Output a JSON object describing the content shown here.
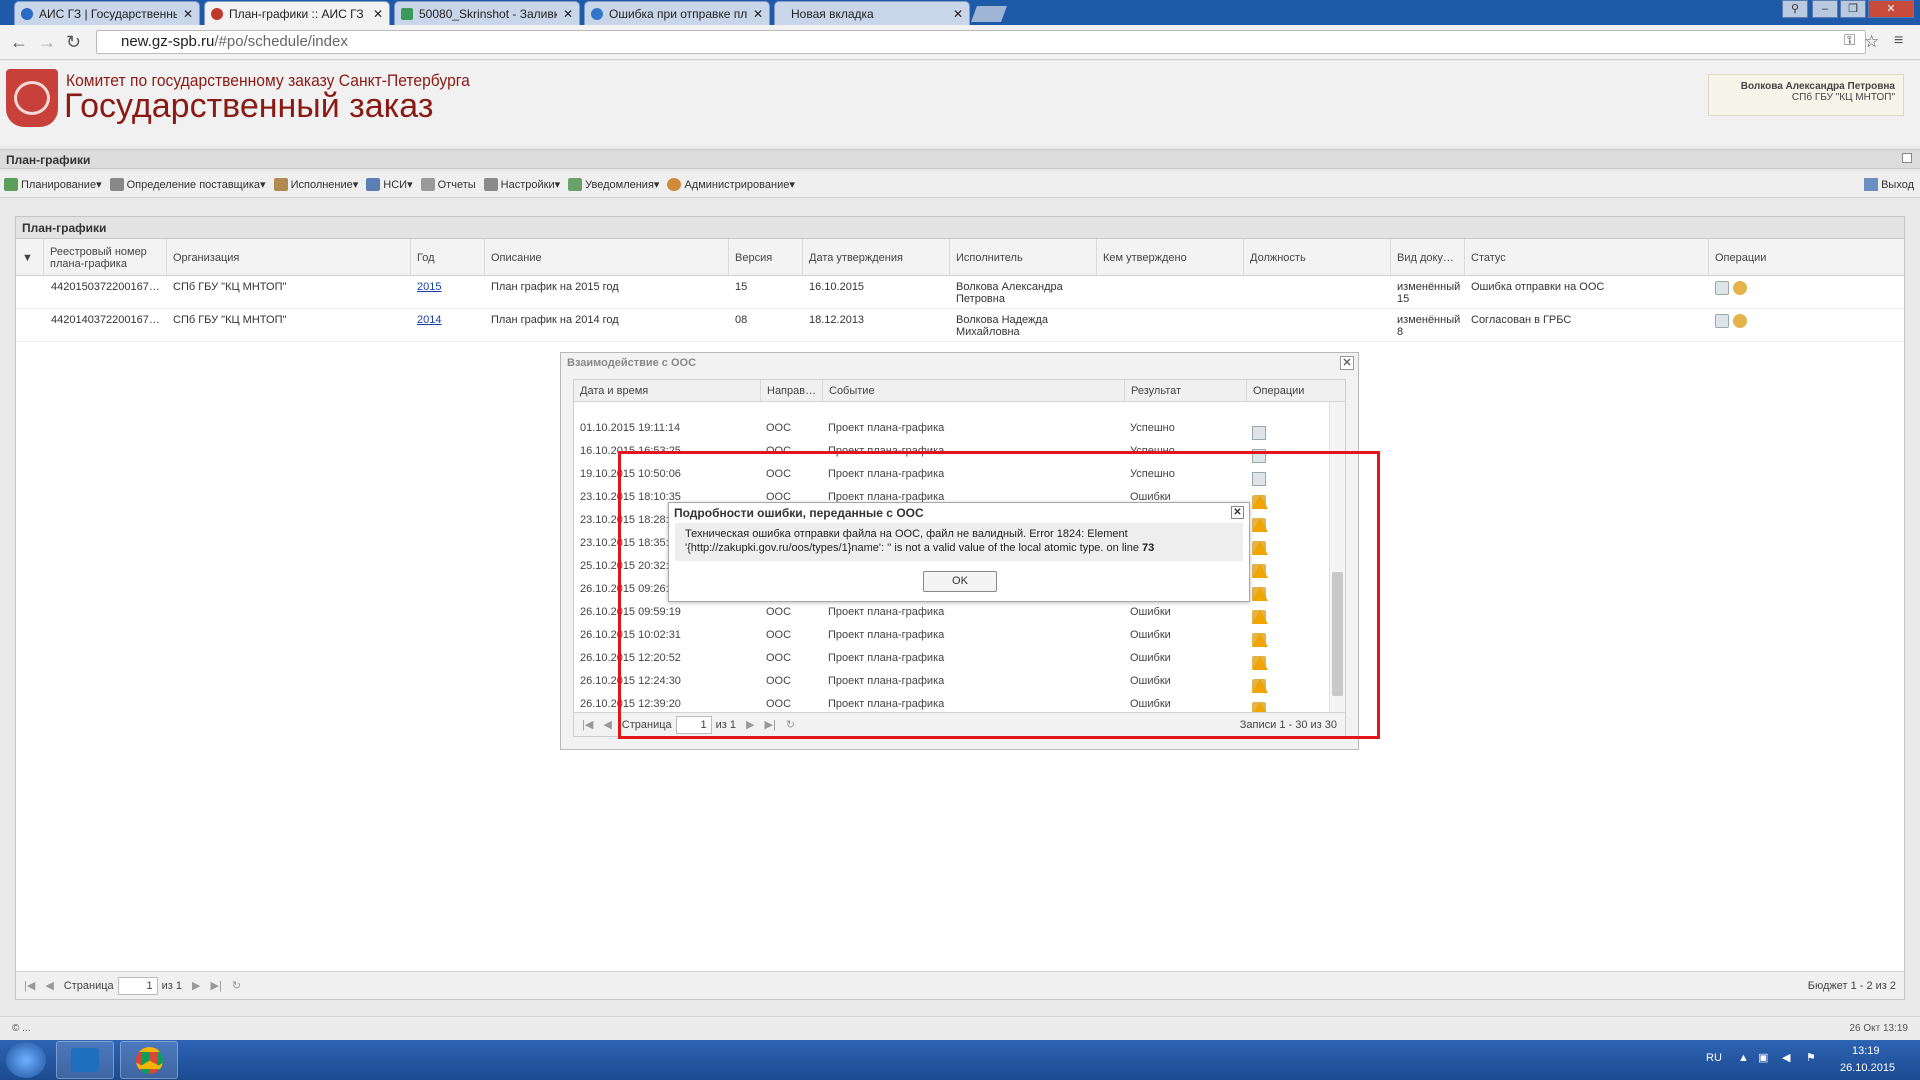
{
  "browser": {
    "tabs": [
      {
        "label": "АИС ГЗ | Государственный"
      },
      {
        "label": "План-графики :: АИС ГЗ"
      },
      {
        "label": "50080_Skrinshot - Заливка"
      },
      {
        "label": "Ошибка при отправке пл"
      },
      {
        "label": "Новая вкладка"
      }
    ],
    "url_host": "new.gz-spb.ru",
    "url_path": "/#po/schedule/index"
  },
  "header": {
    "org": "Комитет по государственному заказу Санкт-Петербурга",
    "site": "Государственный заказ",
    "user_name": "Волкова Александра Петровна",
    "user_org": "СПб ГБУ \"КЦ МНТОП\""
  },
  "module_title": "План-графики",
  "menu": [
    {
      "label": "Планирование",
      "icon": "planning-icon",
      "color": "#5aa05a"
    },
    {
      "label": "Определение поставщика",
      "icon": "gear-icon",
      "color": "#888888"
    },
    {
      "label": "Исполнение",
      "icon": "execution-icon",
      "color": "#b08a50"
    },
    {
      "label": "НСИ",
      "icon": "table-icon",
      "color": "#5a7fb5"
    },
    {
      "label": "Отчеты",
      "icon": "report-icon",
      "color": "#9a9a9a"
    },
    {
      "label": "Настройки",
      "icon": "wrench-icon",
      "color": "#8a8a8a"
    },
    {
      "label": "Уведомления",
      "icon": "notify-icon",
      "color": "#6aa06a"
    },
    {
      "label": "Администрирование",
      "icon": "user-icon",
      "color": "#d08a3a"
    }
  ],
  "exit_label": "Выход",
  "panel": {
    "title": "План-графики",
    "columns": [
      "Реестровый номер плана-графика",
      "Организация",
      "Год",
      "Описание",
      "Версия",
      "Дата утверждения",
      "Исполнитель",
      "Кем утверждено",
      "Должность",
      "Вид доку…",
      "Статус",
      "Операции"
    ],
    "rows": [
      {
        "reg": "4420150372200167…",
        "org": "СПб ГБУ \"КЦ МНТОП\"",
        "year": "2015",
        "desc": "План график на 2015 год",
        "version": "15",
        "date": "16.10.2015",
        "exec1": "Волкова Александра",
        "exec2": "Петровна",
        "doc1": "изменённый",
        "doc2": "15",
        "status": "Ошибка отправки на ООС"
      },
      {
        "reg": "4420140372200167…",
        "org": "СПб ГБУ \"КЦ МНТОП\"",
        "year": "2014",
        "desc": "План график на 2014 год",
        "version": "08",
        "date": "18.12.2013",
        "exec1": "Волкова Надежда",
        "exec2": "Михайловна",
        "doc1": "изменённый",
        "doc2": "8",
        "status": "Согласован в ГРБС"
      }
    ],
    "page_label": "Страница",
    "page_value": "1",
    "page_of": "из 1",
    "summary": "Бюджет 1 - 2 из 2"
  },
  "oos": {
    "title": "Взаимодействие с ООС",
    "columns": [
      "Дата и время",
      "Направ…",
      "Событие",
      "Результат",
      "Операции"
    ],
    "rows": [
      {
        "dt": "01.10.2015 19:11:14",
        "dir": "ООС",
        "event": "Проект плана-графика",
        "result": "Успешно",
        "ok": true
      },
      {
        "dt": "16.10.2015 16:53:25",
        "dir": "ООС",
        "event": "Проект плана-графика",
        "result": "Успешно",
        "ok": true
      },
      {
        "dt": "19.10.2015 10:50:06",
        "dir": "ООС",
        "event": "Проект плана-графика",
        "result": "Успешно",
        "ok": true
      },
      {
        "dt": "23.10.2015 18:10:35",
        "dir": "ООС",
        "event": "Проект плана-графика",
        "result": "Ошибки",
        "ok": false
      },
      {
        "dt": "23.10.2015 18:28:",
        "dir": "",
        "event": "",
        "result": "",
        "ok": false
      },
      {
        "dt": "23.10.2015 18:35:",
        "dir": "",
        "event": "",
        "result": "",
        "ok": false
      },
      {
        "dt": "25.10.2015 20:32:",
        "dir": "",
        "event": "",
        "result": "",
        "ok": false
      },
      {
        "dt": "26.10.2015 09:26:",
        "dir": "",
        "event": "",
        "result": "",
        "ok": false
      },
      {
        "dt": "26.10.2015 09:59:19",
        "dir": "ООС",
        "event": "Проект плана-графика",
        "result": "Ошибки",
        "ok": false
      },
      {
        "dt": "26.10.2015 10:02:31",
        "dir": "ООС",
        "event": "Проект плана-графика",
        "result": "Ошибки",
        "ok": false
      },
      {
        "dt": "26.10.2015 12:20:52",
        "dir": "ООС",
        "event": "Проект плана-графика",
        "result": "Ошибки",
        "ok": false
      },
      {
        "dt": "26.10.2015 12:24:30",
        "dir": "ООС",
        "event": "Проект плана-графика",
        "result": "Ошибки",
        "ok": false
      },
      {
        "dt": "26.10.2015 12:39:20",
        "dir": "ООС",
        "event": "Проект плана-графика",
        "result": "Ошибки",
        "ok": false
      }
    ],
    "page_label": "Страница",
    "page_value": "1",
    "page_of": "из 1",
    "summary": "Записи 1 - 30 из 30"
  },
  "error_dialog": {
    "title": "Подробности ошибки, переданные с ООС",
    "line1": "Техническая ошибка отправки файла на ООС, файл не валидный. Error 1824: Element",
    "line2": "'{http://zakupki.gov.ru/oos/types/1}name': '' is not a valid value of the local atomic type. on line ",
    "line_number": "73",
    "ok_label": "OK"
  },
  "status": {
    "left": "© ...",
    "right": "26 Окт 13:19"
  },
  "taskbar": {
    "lang": "RU",
    "time": "13:19",
    "date": "26.10.2015"
  }
}
